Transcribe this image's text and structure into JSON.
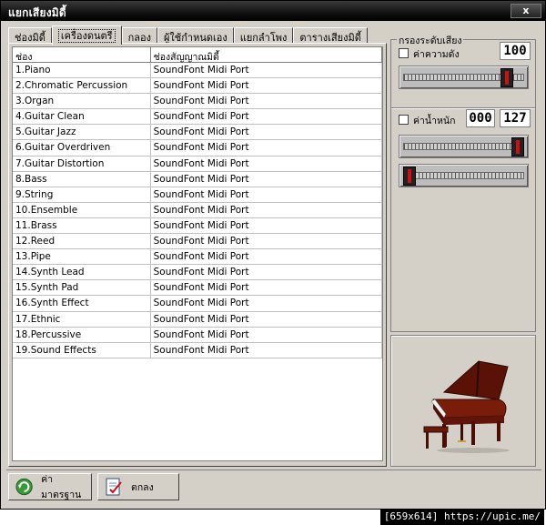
{
  "window": {
    "title": "แยกเสียงมิดี้",
    "close_label": "x"
  },
  "tabs": [
    {
      "label": "ช่องมิดี้"
    },
    {
      "label": "เครื่องดนตรี"
    },
    {
      "label": "กลอง"
    },
    {
      "label": "ผู้ใช้กำหนดเอง"
    },
    {
      "label": "แยกลำโพง"
    },
    {
      "label": "ตารางเสียงมิดี้"
    }
  ],
  "grid": {
    "headers": [
      "ช่อง",
      "ช่องสัญญาณมิดี้"
    ],
    "rows": [
      [
        "1.Piano",
        "SoundFont Midi Port"
      ],
      [
        "2.Chromatic Percussion",
        "SoundFont Midi Port"
      ],
      [
        "3.Organ",
        "SoundFont Midi Port"
      ],
      [
        "4.Guitar Clean",
        "SoundFont Midi Port"
      ],
      [
        "5.Guitar Jazz",
        "SoundFont Midi Port"
      ],
      [
        "6.Guitar Overdriven",
        "SoundFont Midi Port"
      ],
      [
        "7.Guitar Distortion",
        "SoundFont Midi Port"
      ],
      [
        "8.Bass",
        "SoundFont Midi Port"
      ],
      [
        "9.String",
        "SoundFont Midi Port"
      ],
      [
        "10.Ensemble",
        "SoundFont Midi Port"
      ],
      [
        "11.Brass",
        "SoundFont Midi Port"
      ],
      [
        "12.Reed",
        "SoundFont Midi Port"
      ],
      [
        "13.Pipe",
        "SoundFont Midi Port"
      ],
      [
        "14.Synth Lead",
        "SoundFont Midi Port"
      ],
      [
        "15.Synth Pad",
        "SoundFont Midi Port"
      ],
      [
        "16.Synth Effect",
        "SoundFont Midi Port"
      ],
      [
        "17.Ethnic",
        "SoundFont Midi Port"
      ],
      [
        "18.Percussive",
        "SoundFont Midi Port"
      ],
      [
        "19.Sound Effects",
        "SoundFont Midi Port"
      ]
    ]
  },
  "filter": {
    "group_title": "กรองระดับเสียง",
    "loudness": {
      "label": "ค่าความดัง",
      "value": "100",
      "slider_fraction": 0.9
    },
    "weight": {
      "label": "ค่าน้ำหนัก",
      "min_value": "000",
      "max_value": "127",
      "max_slider_fraction": 1.0,
      "min_slider_fraction": 0.0
    }
  },
  "buttons": {
    "default_label": "ค่ามาตรฐาน",
    "ok_label": "ตกลง"
  },
  "watermark": "[659x614] https://upic.me/"
}
